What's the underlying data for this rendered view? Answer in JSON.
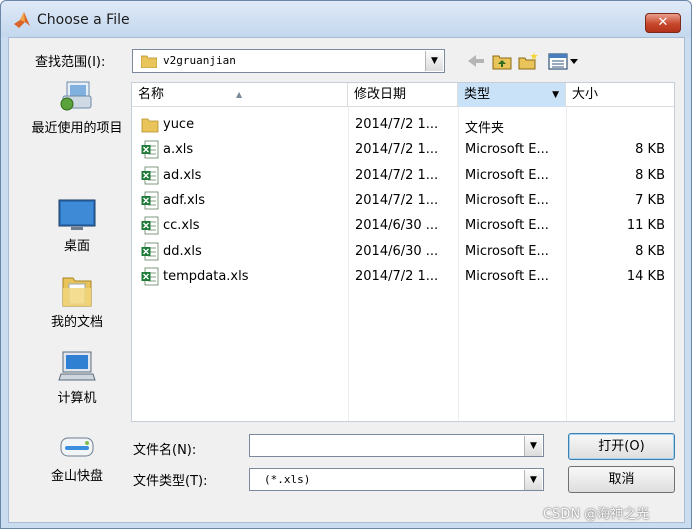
{
  "window": {
    "title": "Choose a File",
    "close_glyph": "✕"
  },
  "lookin": {
    "label": "查找范围(I):",
    "value": "v2gruanjian",
    "tools": [
      "back-arrow-icon",
      "up-folder-icon",
      "new-folder-icon",
      "view-menu-icon"
    ]
  },
  "places": [
    {
      "label": "最近使用的项目",
      "icon": "recent-items-icon"
    },
    {
      "label": "桌面",
      "icon": "desktop-icon"
    },
    {
      "label": "我的文档",
      "icon": "my-documents-icon"
    },
    {
      "label": "计算机",
      "icon": "computer-icon"
    },
    {
      "label": "金山快盘",
      "icon": "kuaipan-icon"
    }
  ],
  "columns": {
    "name": "名称",
    "date": "修改日期",
    "type": "类型",
    "size": "大小"
  },
  "files": [
    {
      "name": "yuce",
      "date": "2014/7/2 1...",
      "type": "文件夹",
      "size": "",
      "icon": "folder-icon"
    },
    {
      "name": "a.xls",
      "date": "2014/7/2 1...",
      "type": "Microsoft E...",
      "size": "8 KB",
      "icon": "excel-file-icon"
    },
    {
      "name": "ad.xls",
      "date": "2014/7/2 1...",
      "type": "Microsoft E...",
      "size": "8 KB",
      "icon": "excel-file-icon"
    },
    {
      "name": "adf.xls",
      "date": "2014/7/2 1...",
      "type": "Microsoft E...",
      "size": "7 KB",
      "icon": "excel-file-icon"
    },
    {
      "name": "cc.xls",
      "date": "2014/6/30 ...",
      "type": "Microsoft E...",
      "size": "11 KB",
      "icon": "excel-file-icon"
    },
    {
      "name": "dd.xls",
      "date": "2014/6/30 ...",
      "type": "Microsoft E...",
      "size": "8 KB",
      "icon": "excel-file-icon"
    },
    {
      "name": "tempdata.xls",
      "date": "2014/7/2 1...",
      "type": "Microsoft E...",
      "size": "14 KB",
      "icon": "excel-file-icon"
    }
  ],
  "filename": {
    "label": "文件名(N):",
    "value": ""
  },
  "filetype": {
    "label": "文件类型(T):",
    "value": "(*.xls)"
  },
  "buttons": {
    "open": "打开(O)",
    "cancel": "取消"
  },
  "watermark": "CSDN @海神之光",
  "colors": {
    "title_bar": "#c9dcf0",
    "close_button": "#c7472c",
    "header_active": "#c9e2f7"
  }
}
